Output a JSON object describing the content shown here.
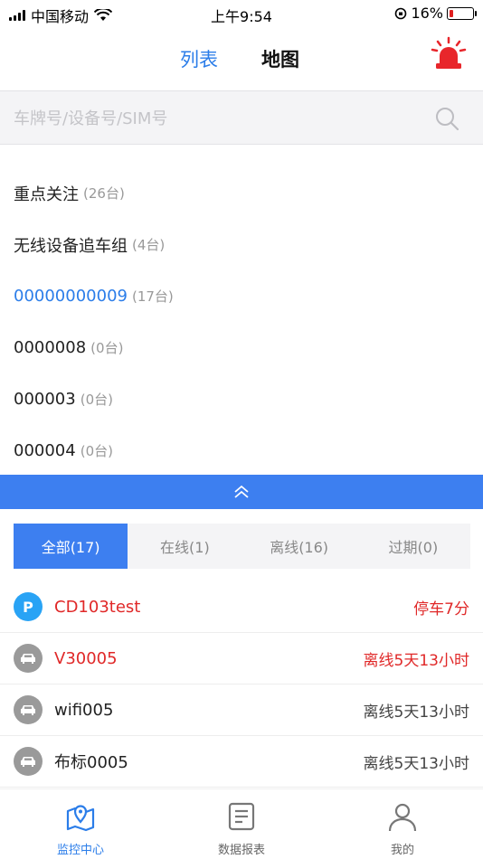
{
  "status_bar": {
    "carrier": "中国移动",
    "time": "上午9:54",
    "battery": "16%",
    "battery_level": 0.16
  },
  "header": {
    "tab_list": "列表",
    "tab_map": "地图",
    "alarm_icon": "siren-icon"
  },
  "search": {
    "placeholder": "车牌号/设备号/SIM号"
  },
  "groups": [
    {
      "name": "重点关注",
      "count": "(26台)",
      "active": false
    },
    {
      "name": "无线设备追车组",
      "count": "(4台)",
      "active": false
    },
    {
      "name": "00000000009",
      "count": "(17台)",
      "active": true
    },
    {
      "name": "0000008",
      "count": "(0台)",
      "active": false
    },
    {
      "name": "000003",
      "count": "(0台)",
      "active": false
    },
    {
      "name": "000004",
      "count": "(0台)",
      "active": false
    }
  ],
  "filters": [
    {
      "label": "全部(17)",
      "active": true
    },
    {
      "label": "在线(1)",
      "active": false
    },
    {
      "label": "离线(16)",
      "active": false
    },
    {
      "label": "过期(0)",
      "active": false
    }
  ],
  "vehicles": [
    {
      "icon": "P",
      "name": "CD103test",
      "status": "停车7分",
      "alert": true,
      "type": "parked"
    },
    {
      "icon": "car-icon",
      "name": "V30005",
      "status": "离线5天13小时",
      "alert": true,
      "type": "offline"
    },
    {
      "icon": "car-icon",
      "name": "wifi005",
      "status": "离线5天13小时",
      "alert": false,
      "type": "offline"
    },
    {
      "icon": "car-icon",
      "name": "布标0005",
      "status": "离线5天13小时",
      "alert": false,
      "type": "offline"
    }
  ],
  "nav": [
    {
      "label": "监控中心",
      "icon": "map-pin-icon",
      "active": true
    },
    {
      "label": "数据报表",
      "icon": "report-icon",
      "active": false
    },
    {
      "label": "我的",
      "icon": "user-icon",
      "active": false
    }
  ],
  "colors": {
    "accent": "#3d7ff0",
    "alert": "#e02828",
    "parked": "#29a3f5"
  }
}
